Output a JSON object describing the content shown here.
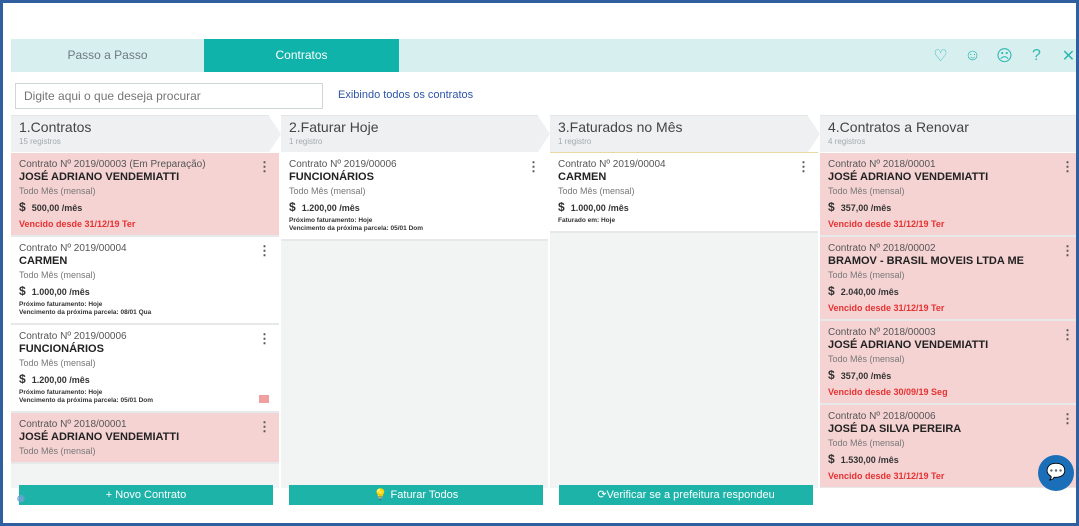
{
  "tabs": [
    {
      "label": "Passo a Passo"
    },
    {
      "label": "Contratos"
    }
  ],
  "top_icons": [
    "heart-icon",
    "smile-icon",
    "neutral-face-icon",
    "help-icon",
    "close-icon"
  ],
  "search": {
    "placeholder": "Digite aqui o que deseja procurar"
  },
  "showing_label": "Exibindo todos os contratos",
  "columns": [
    {
      "title": "1.Contratos",
      "subtitle": "15 registros",
      "cards": [
        {
          "number": "Contrato Nº 2019/00003 (Em Preparação)",
          "client": "JOSÉ ADRIANO VENDEMIATTI",
          "period": "Todo Mês (mensal)",
          "value": "500,00 /mês",
          "overdue": "Vencido desde 31/12/19 Ter",
          "color": "red"
        },
        {
          "number": "Contrato Nº 2019/00004",
          "client": "CARMEN",
          "period": "Todo Mês (mensal)",
          "value": "1.000,00 /mês",
          "line1": "Próximo faturamento: Hoje",
          "line2": "Vencimento da próxima parcela: 08/01 Qua",
          "color": "white"
        },
        {
          "number": "Contrato Nº 2019/00006",
          "client": "FUNCIONÁRIOS",
          "period": "Todo Mês (mensal)",
          "value": "1.200,00 /mês",
          "line1": "Próximo faturamento: Hoje",
          "line2": "Vencimento da próxima parcela: 05/01 Dom",
          "color": "white"
        },
        {
          "number": "Contrato Nº 2018/00001",
          "client": "JOSÉ ADRIANO VENDEMIATTI",
          "period": "Todo Mês (mensal)",
          "color": "red"
        }
      ],
      "button": "+ Novo Contrato"
    },
    {
      "title": "2.Faturar Hoje",
      "subtitle": "1 registro",
      "cards": [
        {
          "number": "Contrato Nº 2019/00006",
          "client": "FUNCIONÁRIOS",
          "period": "Todo Mês (mensal)",
          "value": "1.200,00 /mês",
          "line1": "Próximo faturamento: Hoje",
          "line2": "Vencimento da próxima parcela: 05/01 Dom",
          "color": "white"
        }
      ],
      "button": "Faturar Todos"
    },
    {
      "title": "3.Faturados no Mês",
      "subtitle": "1 registro",
      "cards": [
        {
          "number": "Contrato Nº 2019/00004",
          "client": "CARMEN",
          "period": "Todo Mês (mensal)",
          "value": "1.000,00 /mês",
          "line1": "Faturado em: Hoje",
          "color": "white"
        }
      ],
      "button": "Verificar se a prefeitura respondeu"
    },
    {
      "title": "4.Contratos a Renovar",
      "subtitle": "4 registros",
      "cards": [
        {
          "number": "Contrato Nº 2018/00001",
          "client": "JOSÉ ADRIANO VENDEMIATTI",
          "period": "Todo Mês (mensal)",
          "value": "357,00 /mês",
          "overdue": "Vencido desde 31/12/19 Ter",
          "color": "red"
        },
        {
          "number": "Contrato Nº 2018/00002",
          "client": "BRAMOV - BRASIL MOVEIS LTDA ME",
          "period": "Todo Mês (mensal)",
          "value": "2.040,00 /mês",
          "overdue": "Vencido desde 31/12/19 Ter",
          "color": "red"
        },
        {
          "number": "Contrato Nº 2018/00003",
          "client": "JOSÉ ADRIANO VENDEMIATTI",
          "period": "Todo Mês (mensal)",
          "value": "357,00 /mês",
          "overdue": "Vencido desde 30/09/19 Seg",
          "color": "red"
        },
        {
          "number": "Contrato Nº 2018/00006",
          "client": "JOSÉ DA SILVA PEREIRA",
          "period": "Todo Mês (mensal)",
          "value": "1.530,00 /mês",
          "overdue": "Vencido desde 31/12/19 Ter",
          "color": "red"
        }
      ]
    }
  ],
  "currency": "$",
  "colors": {
    "accent": "#1eb3a9",
    "overdue": "#e63232",
    "card_red": "#f6d3d3",
    "frame": "#2f5f9e"
  }
}
